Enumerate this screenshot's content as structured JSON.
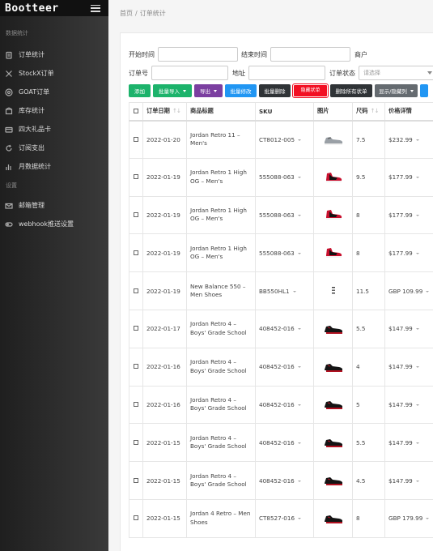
{
  "app": {
    "brand": "Bootteer"
  },
  "sidebar": {
    "section1": "数据统计",
    "items": [
      {
        "label": "订单统计",
        "icon": "clipboard-icon"
      },
      {
        "label": "StockX订单",
        "icon": "x-icon"
      },
      {
        "label": "GOAT订单",
        "icon": "circle-g-icon"
      },
      {
        "label": "库存统计",
        "icon": "box-icon"
      },
      {
        "label": "四大礼品卡",
        "icon": "gift-card-icon"
      },
      {
        "label": "订阅支出",
        "icon": "refresh-icon"
      },
      {
        "label": "月数据统计",
        "icon": "bar-chart-icon"
      }
    ],
    "section2": "设置",
    "settings": [
      {
        "label": "邮箱管理",
        "icon": "mail-icon"
      },
      {
        "label": "webhook推送设置",
        "icon": "webhook-icon"
      }
    ]
  },
  "breadcrumb": {
    "home": "首页",
    "sep": "/",
    "current": "订单统计"
  },
  "filters": {
    "start_label": "开始时间",
    "end_label": "结束时间",
    "merchant_label": "商户",
    "order_label": "订单号",
    "address_label": "地址",
    "status_label": "订单状态",
    "status_placeholder": "请选择"
  },
  "toolbar": {
    "add": "添加",
    "batch_import": "批量导入",
    "export": "导出",
    "batch_edit": "批量修改",
    "batch_delete": "批量删除",
    "hide_orders": "隐藏状单",
    "delete_all": "删除所有状单",
    "toggle_columns": "显示/隐藏列"
  },
  "table": {
    "headers": {
      "date": "订单日期",
      "title": "商品标题",
      "sku": "SKU",
      "image": "图片",
      "size": "尺码",
      "price": "价格详情"
    },
    "rows": [
      {
        "date": "2022-01-20",
        "title": "Jordan Retro 11 – Men's",
        "sku": "CT8012-005",
        "shoe": "gray",
        "size": "7.5",
        "price": "$232.99"
      },
      {
        "date": "2022-01-19",
        "title": "Jordan Retro 1 High OG – Men's",
        "sku": "555088-063",
        "shoe": "redblack",
        "size": "9.5",
        "price": "$177.99"
      },
      {
        "date": "2022-01-19",
        "title": "Jordan Retro 1 High OG – Men's",
        "sku": "555088-063",
        "shoe": "redblack",
        "size": "8",
        "price": "$177.99"
      },
      {
        "date": "2022-01-19",
        "title": "Jordan Retro 1 High OG – Men's",
        "sku": "555088-063",
        "shoe": "redblack",
        "size": "8",
        "price": "$177.99"
      },
      {
        "date": "2022-01-19",
        "title": "New Balance 550 – Men Shoes",
        "sku": "BB550HL1",
        "shoe": "nb",
        "size": "11.5",
        "price": "GBP 109.99"
      },
      {
        "date": "2022-01-17",
        "title": "Jordan Retro 4 – Boys' Grade School",
        "sku": "408452-016",
        "shoe": "black4",
        "size": "5.5",
        "price": "$147.99"
      },
      {
        "date": "2022-01-16",
        "title": "Jordan Retro 4 – Boys' Grade School",
        "sku": "408452-016",
        "shoe": "black4",
        "size": "4",
        "price": "$147.99"
      },
      {
        "date": "2022-01-16",
        "title": "Jordan Retro 4 – Boys' Grade School",
        "sku": "408452-016",
        "shoe": "black4",
        "size": "5",
        "price": "$147.99"
      },
      {
        "date": "2022-01-15",
        "title": "Jordan Retro 4 – Boys' Grade School",
        "sku": "408452-016",
        "shoe": "black4",
        "size": "5.5",
        "price": "$147.99"
      },
      {
        "date": "2022-01-15",
        "title": "Jordan Retro 4 – Boys' Grade School",
        "sku": "408452-016",
        "shoe": "black4",
        "size": "4.5",
        "price": "$147.99"
      },
      {
        "date": "2022-01-15",
        "title": "Jordan 4 Retro – Men Shoes",
        "sku": "CT8527-016",
        "shoe": "black4",
        "size": "8",
        "price": "GBP 179.99"
      }
    ]
  }
}
